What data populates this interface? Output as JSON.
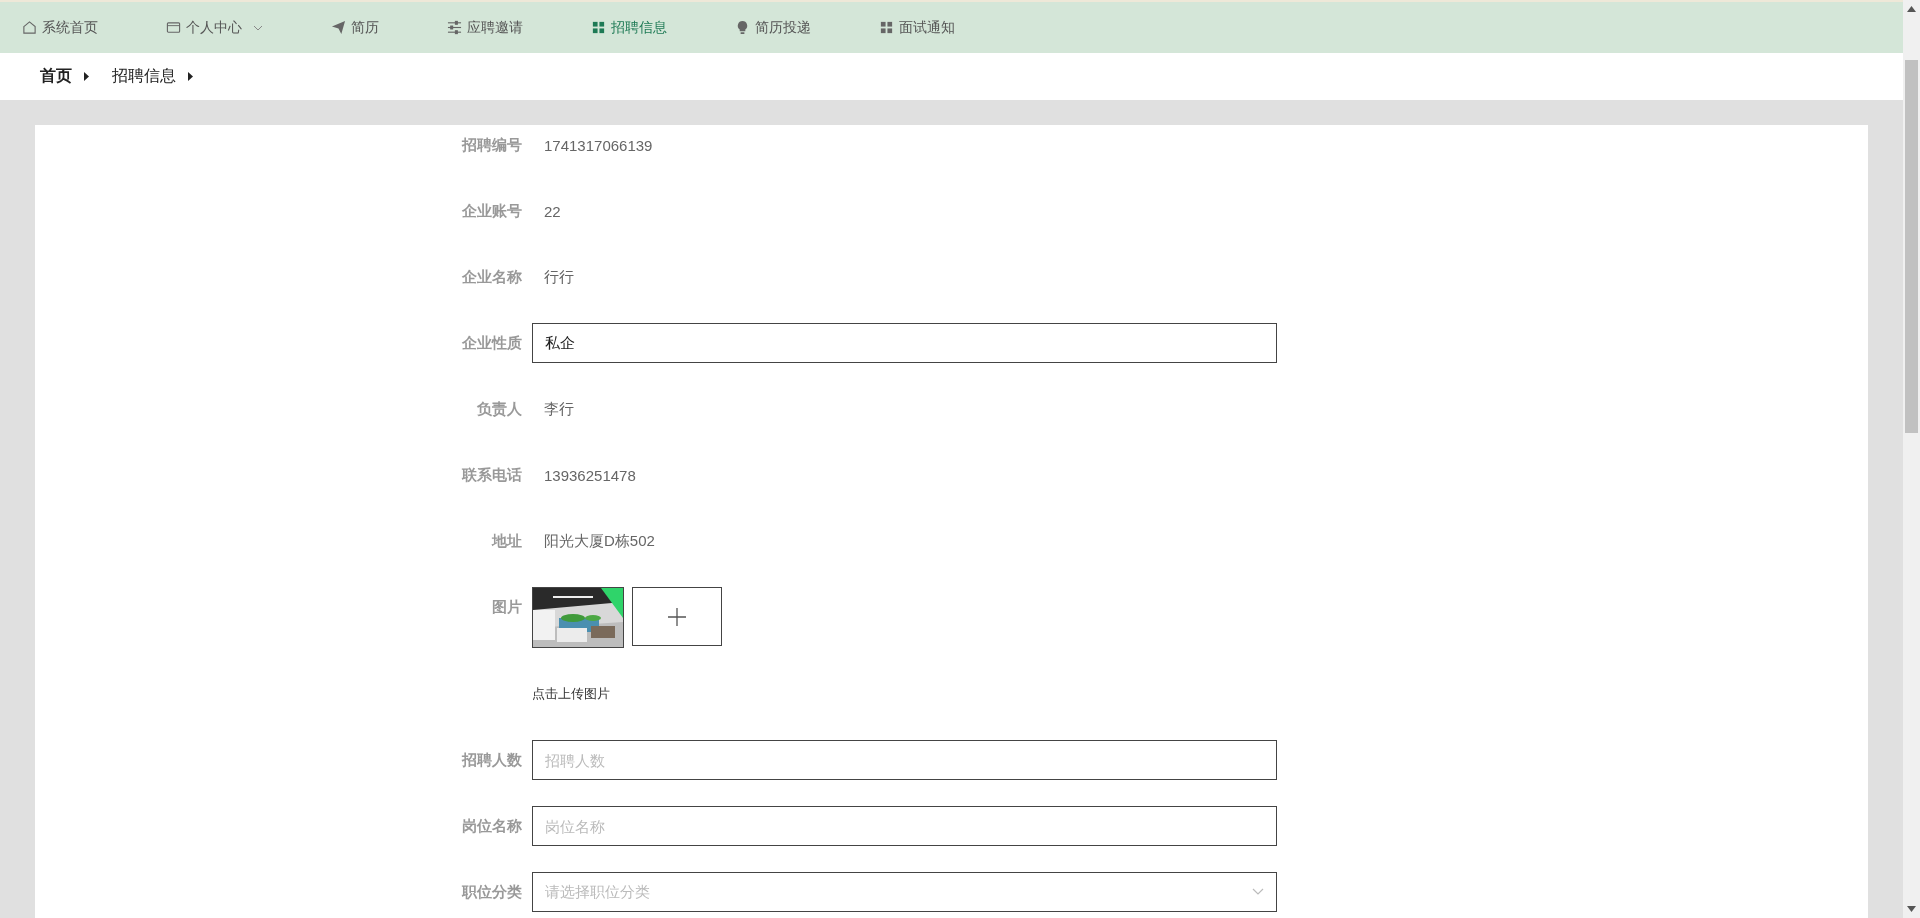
{
  "nav": [
    {
      "label": "系统首页",
      "kind": "home",
      "selected": false,
      "dropdown": false
    },
    {
      "label": "个人中心",
      "kind": "card",
      "selected": false,
      "dropdown": true
    },
    {
      "label": "简历",
      "kind": "send",
      "selected": false,
      "dropdown": false
    },
    {
      "label": "应聘邀请",
      "kind": "sliders",
      "selected": false,
      "dropdown": false
    },
    {
      "label": "招聘信息",
      "kind": "grid",
      "selected": true,
      "dropdown": false
    },
    {
      "label": "简历投递",
      "kind": "bulb",
      "selected": false,
      "dropdown": false
    },
    {
      "label": "面试通知",
      "kind": "grid",
      "selected": false,
      "dropdown": false
    }
  ],
  "breadcrumb": [
    "首页",
    "招聘信息"
  ],
  "fields": [
    {
      "kind": "text",
      "label": "招聘编号",
      "value": "1741317066139"
    },
    {
      "kind": "text",
      "label": "企业账号",
      "value": "22"
    },
    {
      "kind": "text",
      "label": "企业名称",
      "value": "行行"
    },
    {
      "kind": "input",
      "label": "企业性质",
      "value": "私企"
    },
    {
      "kind": "text",
      "label": "负责人",
      "value": "李行"
    },
    {
      "kind": "text",
      "label": "联系电话",
      "value": "13936251478"
    },
    {
      "kind": "text",
      "label": "地址",
      "value": "阳光大厦D栋502"
    },
    {
      "kind": "images",
      "label": "图片",
      "hint": "点击上传图片"
    },
    {
      "kind": "input",
      "label": "招聘人数",
      "placeholder": "招聘人数"
    },
    {
      "kind": "input",
      "label": "岗位名称",
      "placeholder": "岗位名称"
    },
    {
      "kind": "select",
      "label": "职位分类",
      "placeholder": "请选择职位分类"
    }
  ]
}
